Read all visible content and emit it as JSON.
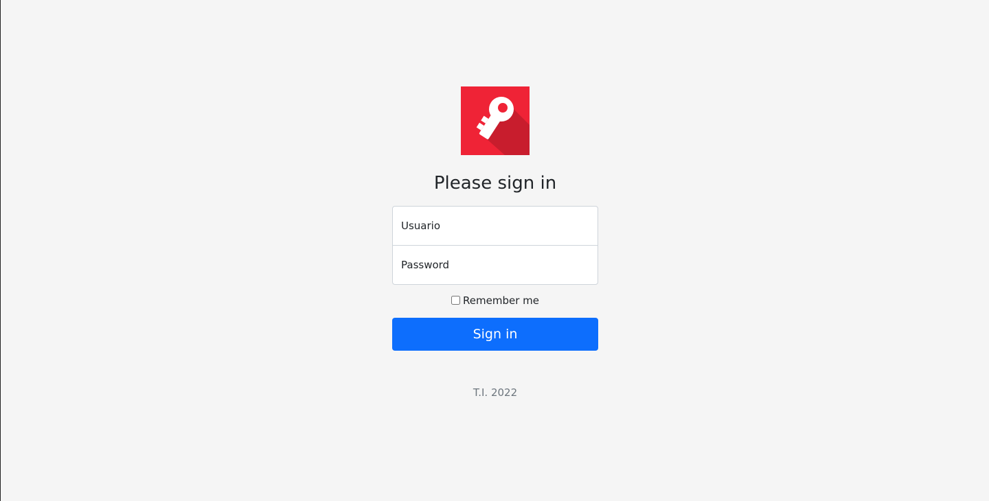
{
  "logo": {
    "icon": "key-icon",
    "background_color": "#ef2336",
    "shadow_color": "#c81d2d"
  },
  "form": {
    "title": "Please sign in",
    "username_placeholder": "Usuario",
    "password_placeholder": "Password",
    "remember_label": "Remember me",
    "remember_checked": false,
    "submit_label": "Sign in"
  },
  "footer": {
    "text": "T.I. 2022"
  },
  "colors": {
    "background": "#f5f5f5",
    "primary_button": "#0d6efd"
  }
}
